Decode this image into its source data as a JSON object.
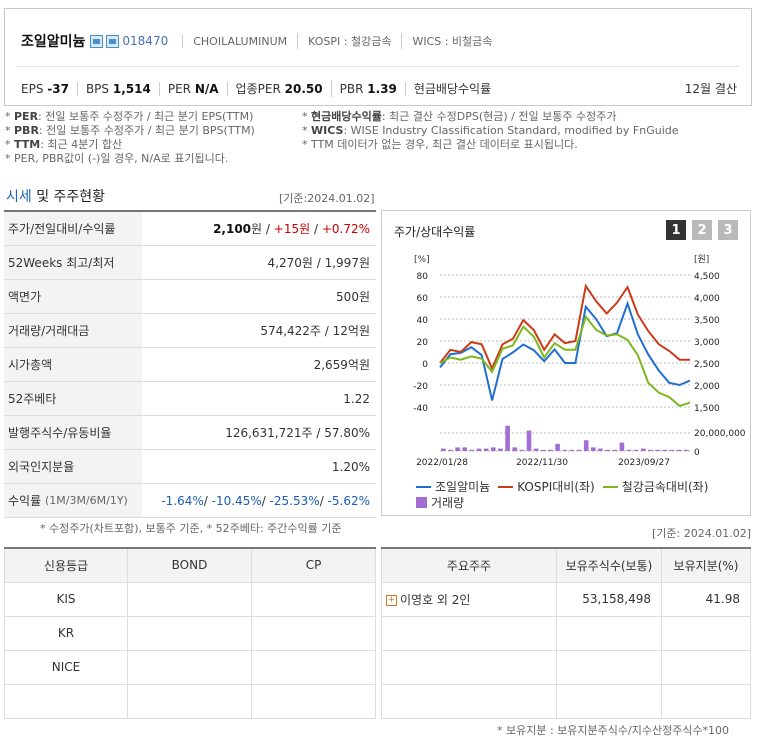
{
  "header": {
    "name": "조일알미늄",
    "code": "018470",
    "eng_name": "CHOILALUMINUM",
    "market": "KOSPI : 철강금속",
    "wics": "WICS : 비철금속",
    "eps_label": "EPS",
    "eps": "-37",
    "bps_label": "BPS",
    "bps": "1,514",
    "per_label": "PER",
    "per": "N/A",
    "ind_per_label": "업종PER",
    "ind_per": "20.50",
    "pbr_label": "PBR",
    "pbr": "1.39",
    "div_label": "현금배당수익률",
    "settle": "12월 결산"
  },
  "notes": {
    "left": [
      {
        "key": "PER",
        "text": ": 전일 보통주 수정주가 / 최근 분기 EPS(TTM)"
      },
      {
        "key": "PBR",
        "text": ": 전일 보통주 수정주가 / 최근 분기 BPS(TTM)"
      },
      {
        "key": "TTM",
        "text": ": 최근 4분기 합산"
      },
      {
        "key": "",
        "text": "PER, PBR값이 (-)일 경우, N/A로 표기됩니다."
      }
    ],
    "right": [
      {
        "key": "현금배당수익률",
        "text": ": 최근 결산 수정DPS(현금) / 전일 보통주 수정주가"
      },
      {
        "key": "WICS",
        "text": ": WISE Industry Classification Standard, modified by FnGuide"
      },
      {
        "key": "",
        "text": "TTM 데이터가 없는 경우, 최근 결산 데이터로 표시됩니다."
      }
    ]
  },
  "section": {
    "title_a": "시세",
    "title_b": " 및 주주현황",
    "date": "[기준:2024.01.02]"
  },
  "stats": [
    {
      "label": "주가/전일대비/수익률",
      "value": "2,100원 / +15원 / +0.72%"
    },
    {
      "label": "52Weeks 최고/최저",
      "value": "4,270원 / 1,997원"
    },
    {
      "label": "액면가",
      "value": "500원"
    },
    {
      "label": "거래량/거래대금",
      "value": "574,422주 / 12억원"
    },
    {
      "label": "시가총액",
      "value": "2,659억원"
    },
    {
      "label": "52주베타",
      "value": "1.22"
    },
    {
      "label": "발행주식수/유동비율",
      "value": "126,631,721주 / 57.80%"
    },
    {
      "label": "외국인지분율",
      "value": "1.20%"
    },
    {
      "label": "수익률",
      "label_sub": "(1M/3M/6M/1Y)",
      "value": "-1.64%/ -10.45%/ -25.53%/ -5.62%"
    }
  ],
  "stats_parts": {
    "price": "2,100",
    "unit": "원",
    "chg": "+15원",
    "rate": "+0.72%",
    "sep": " / ",
    "ret": [
      "-1.64%",
      "-10.45%",
      "-25.53%",
      "-5.62%"
    ]
  },
  "stats_note": "* 수정주가(차트포함), 보통주 기준, * 52주베타: 주간수익률 기준",
  "chart_box": {
    "title": "주가/상대수익률",
    "buttons": [
      "1",
      "2",
      "3"
    ]
  },
  "chart_data": {
    "type": "line",
    "y_left_unit": "[%]",
    "y_right_unit": "[원]",
    "y_left_ticks": [
      "80",
      "60",
      "40",
      "20",
      "0",
      "-20",
      "-40"
    ],
    "y_right_ticks": [
      "4,500",
      "4,000",
      "3,500",
      "3,000",
      "2,500",
      "2,000",
      "1,500"
    ],
    "volume_ticks": [
      "20,000,000",
      "0"
    ],
    "x_ticks": [
      "2022/01/28",
      "2022/11/30",
      "2023/09/27"
    ],
    "ylim_left": [
      -40,
      80
    ],
    "ylim_right": [
      1500,
      4500
    ],
    "series": [
      {
        "name": "조일알미늄",
        "color": "#1f6fd2",
        "axis": "right",
        "values": [
          2400,
          2700,
          2730,
          2860,
          2680,
          1650,
          2590,
          2740,
          2920,
          2790,
          2540,
          2810,
          2500,
          2500,
          3780,
          3490,
          3110,
          3180,
          3850,
          3150,
          2690,
          2330,
          2050,
          2000,
          2100
        ]
      },
      {
        "name": "KOSPI대비(좌)",
        "color": "#cc3a16",
        "axis": "left",
        "values": [
          0,
          12,
          10,
          19,
          17,
          -5,
          17,
          22,
          39,
          30,
          12,
          26,
          18,
          20,
          70,
          56,
          45,
          55,
          69,
          44,
          29,
          17,
          11,
          3,
          3
        ]
      },
      {
        "name": "철강금속대비(좌)",
        "color": "#7cb81c",
        "axis": "left",
        "values": [
          0,
          5,
          3,
          6,
          4,
          -8,
          13,
          16,
          33,
          24,
          5,
          18,
          12,
          12,
          42,
          30,
          25,
          26,
          21,
          7,
          -18,
          -27,
          -31,
          -39,
          -36
        ]
      }
    ],
    "volume": {
      "name": "거래량",
      "color": "#a36ed3",
      "values": [
        2,
        1,
        3,
        3,
        1,
        2,
        2,
        3,
        2,
        21,
        3,
        1,
        17,
        2,
        1,
        1,
        6,
        1,
        1,
        1,
        9,
        3,
        2,
        1,
        1,
        7,
        1,
        1,
        2,
        1,
        1,
        1,
        1,
        1,
        1
      ]
    }
  },
  "credit": {
    "headers": [
      "신용등급",
      "BOND",
      "CP"
    ],
    "rows": [
      "KIS",
      "KR",
      "NICE"
    ]
  },
  "holders": {
    "date": "[기준: 2024.01.02]",
    "headers": [
      "주요주주",
      "보유주식수(보통)",
      "보유지분(%)"
    ],
    "rows": [
      {
        "name": "이영호 외 2인",
        "shares": "53,158,498",
        "pct": "41.98"
      }
    ],
    "footnote": "* 보유지분 : 보유지분주식수/지수산정주식수*100"
  }
}
